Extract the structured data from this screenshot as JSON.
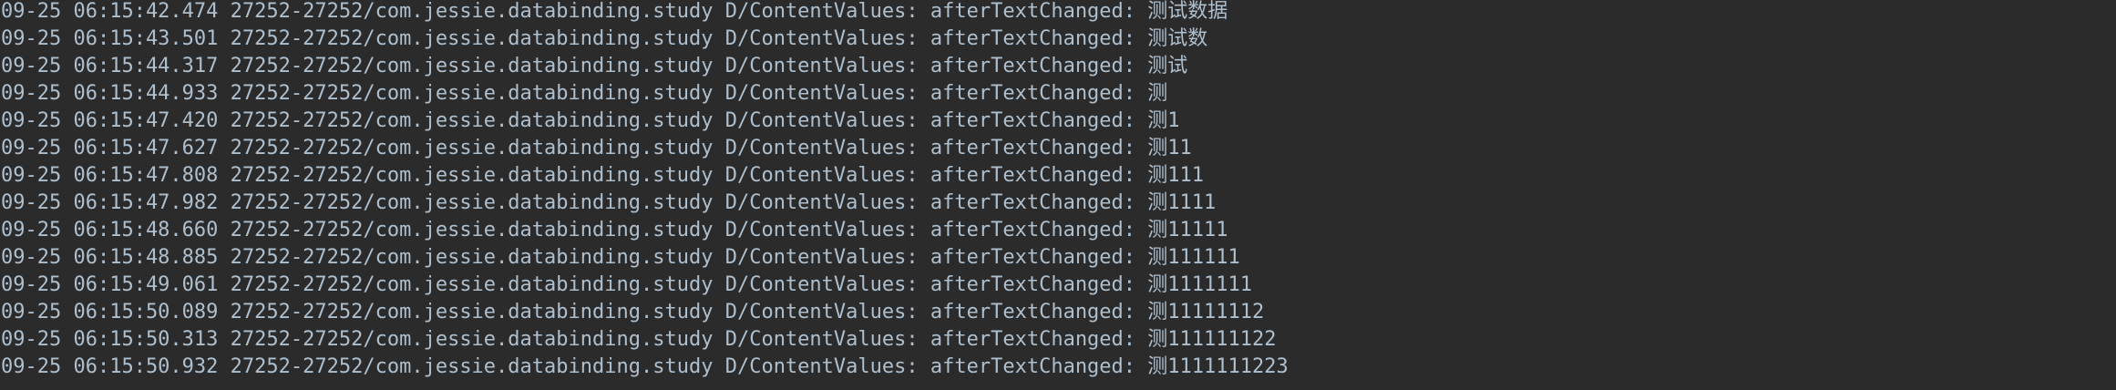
{
  "console": {
    "lines": [
      "09-25 06:15:42.474 27252-27252/com.jessie.databinding.study D/ContentValues: afterTextChanged: 测试数据",
      "09-25 06:15:43.501 27252-27252/com.jessie.databinding.study D/ContentValues: afterTextChanged: 测试数",
      "09-25 06:15:44.317 27252-27252/com.jessie.databinding.study D/ContentValues: afterTextChanged: 测试",
      "09-25 06:15:44.933 27252-27252/com.jessie.databinding.study D/ContentValues: afterTextChanged: 测",
      "09-25 06:15:47.420 27252-27252/com.jessie.databinding.study D/ContentValues: afterTextChanged: 测1",
      "09-25 06:15:47.627 27252-27252/com.jessie.databinding.study D/ContentValues: afterTextChanged: 测11",
      "09-25 06:15:47.808 27252-27252/com.jessie.databinding.study D/ContentValues: afterTextChanged: 测111",
      "09-25 06:15:47.982 27252-27252/com.jessie.databinding.study D/ContentValues: afterTextChanged: 测1111",
      "09-25 06:15:48.660 27252-27252/com.jessie.databinding.study D/ContentValues: afterTextChanged: 测11111",
      "09-25 06:15:48.885 27252-27252/com.jessie.databinding.study D/ContentValues: afterTextChanged: 测111111",
      "09-25 06:15:49.061 27252-27252/com.jessie.databinding.study D/ContentValues: afterTextChanged: 测1111111",
      "09-25 06:15:50.089 27252-27252/com.jessie.databinding.study D/ContentValues: afterTextChanged: 测11111112",
      "09-25 06:15:50.313 27252-27252/com.jessie.databinding.study D/ContentValues: afterTextChanged: 测111111122",
      "09-25 06:15:50.932 27252-27252/com.jessie.databinding.study D/ContentValues: afterTextChanged: 测1111111223"
    ],
    "colors": {
      "background": "#2b2b2b",
      "text": "#aebfce"
    }
  }
}
